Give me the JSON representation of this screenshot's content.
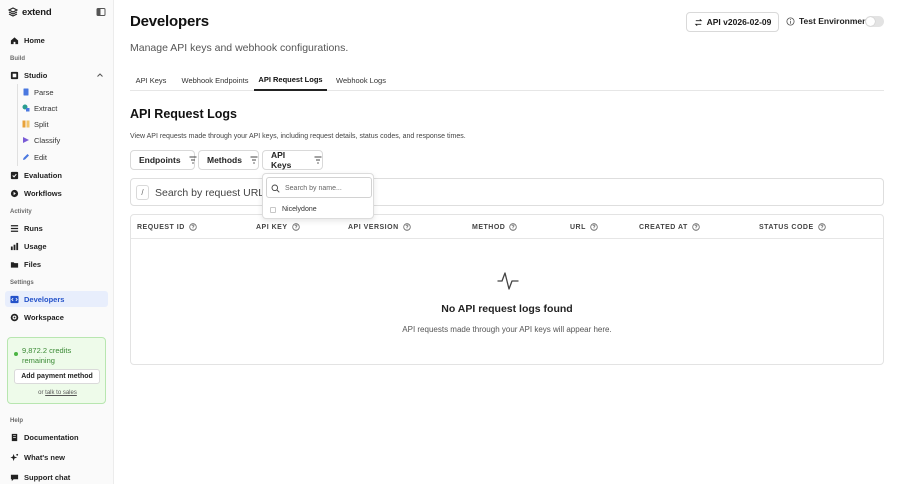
{
  "app": {
    "logo_text": "extend"
  },
  "sidebar": {
    "home": "Home",
    "sections": {
      "build": "Build",
      "activity": "Activity",
      "settings": "Settings",
      "help": "Help"
    },
    "studio": "Studio",
    "studio_items": [
      "Parse",
      "Extract",
      "Split",
      "Classify",
      "Edit"
    ],
    "evaluation": "Evaluation",
    "workflows": "Workflows",
    "runs": "Runs",
    "usage": "Usage",
    "files": "Files",
    "developers": "Developers",
    "workspace": "Workspace",
    "credits": {
      "text": "9,872.2 credits remaining",
      "pay_button": "Add payment method",
      "or_text": "or",
      "sales_link": "talk to sales"
    },
    "documentation": "Documentation",
    "whats_new": "What's new",
    "support_chat": "Support chat"
  },
  "header": {
    "title": "Developers",
    "subtitle": "Manage API keys and webhook configurations.",
    "api_version": "API v2026-02-09",
    "test_env_label": "Test Environment",
    "test_env_enabled": false
  },
  "tabs": [
    {
      "label": "API Keys",
      "active": false
    },
    {
      "label": "Webhook Endpoints",
      "active": false
    },
    {
      "label": "API Request Logs",
      "active": true
    },
    {
      "label": "Webhook Logs",
      "active": false
    }
  ],
  "logs": {
    "title": "API Request Logs",
    "description": "View API requests made through your API keys, including request details, status codes, and response times.",
    "filters": [
      "Endpoints",
      "Methods",
      "API Keys"
    ],
    "search_shortcut": "/",
    "search_placeholder": "Search by request URL or ID...",
    "columns": [
      "REQUEST ID",
      "API KEY",
      "API VERSION",
      "METHOD",
      "URL",
      "CREATED AT",
      "STATUS CODE"
    ],
    "empty_title": "No API request logs found",
    "empty_desc": "API requests made through your API keys will appear here."
  },
  "dropdown": {
    "search_placeholder": "Search by name...",
    "options": [
      "Nicelydone"
    ]
  },
  "colors": {
    "accent": "#2452c9",
    "credits_green": "#3a8a34",
    "active_bg": "#e8eefc"
  }
}
